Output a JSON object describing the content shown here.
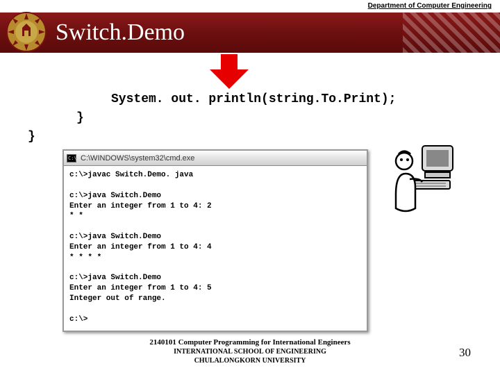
{
  "header": {
    "dept": "Department of Computer Engineering",
    "title": "Switch.Demo"
  },
  "code": {
    "line1": "System. out. println(string.To.Print);",
    "line2": "}",
    "line3": "}"
  },
  "cmd": {
    "icon_text": "C:\\",
    "title": "C:\\WINDOWS\\system32\\cmd.exe",
    "body": "c:\\>javac Switch.Demo. java\n\nc:\\>java Switch.Demo\nEnter an integer from 1 to 4: 2\n* *\n\nc:\\>java Switch.Demo\nEnter an integer from 1 to 4: 4\n* * * *\n\nc:\\>java Switch.Demo\nEnter an integer from 1 to 4: 5\nInteger out of range.\n\nc:\\>"
  },
  "footer": {
    "line1": "2140101 Computer Programming for International Engineers",
    "line2": "INTERNATIONAL SCHOOL OF ENGINEERING",
    "line3": "CHULALONGKORN UNIVERSITY"
  },
  "page": "30"
}
